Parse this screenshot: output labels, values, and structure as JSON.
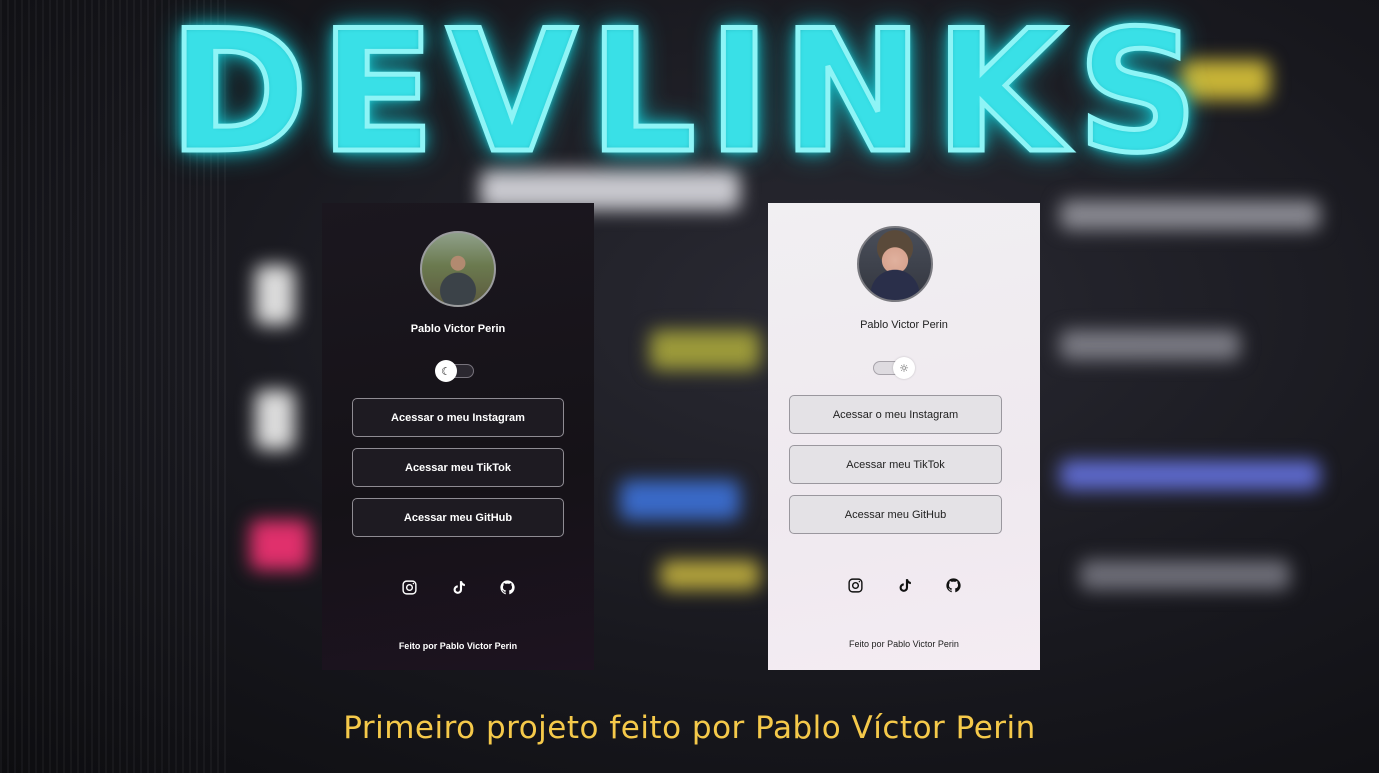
{
  "title": "DEVLINKS",
  "caption": "Primeiro projeto feito por Pablo Víctor Perin",
  "dark_card": {
    "theme": "dark",
    "name": "Pablo Victor Perin",
    "toggle_icon": "moon-icon",
    "buttons": [
      "Acessar o meu Instagram",
      "Acessar meu TikTok",
      "Acessar meu GitHub"
    ],
    "social_icons": [
      "instagram-icon",
      "tiktok-icon",
      "github-icon"
    ],
    "footer": "Feito por Pablo Victor Perin"
  },
  "light_card": {
    "theme": "light",
    "name": "Pablo Victor Perin",
    "toggle_icon": "sun-icon",
    "buttons": [
      "Acessar o meu Instagram",
      "Acessar meu TikTok",
      "Acessar meu GitHub"
    ],
    "social_icons": [
      "instagram-icon",
      "tiktok-icon",
      "github-icon"
    ],
    "footer": "Feito por Pablo Victor Perin"
  },
  "colors": {
    "neon": "#8ef4f6",
    "caption": "#f5c94a",
    "dark_card_bg": "#1b171f",
    "light_card_bg": "#f1eff2"
  }
}
